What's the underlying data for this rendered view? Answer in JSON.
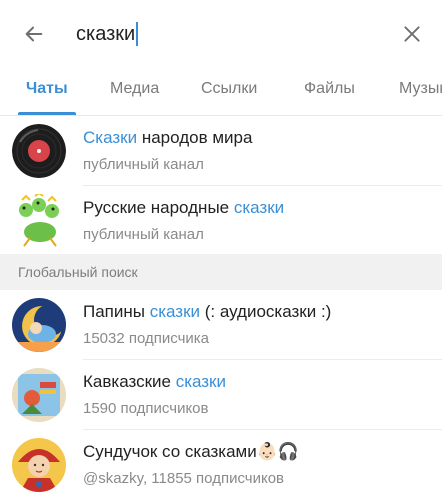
{
  "search": {
    "query": "сказки"
  },
  "tabs": [
    {
      "label": "Чаты"
    },
    {
      "label": "Медиа"
    },
    {
      "label": "Ссылки"
    },
    {
      "label": "Файлы"
    },
    {
      "label": "Музыка"
    }
  ],
  "local_results": [
    {
      "title_parts": [
        "Сказки",
        " народов мира"
      ],
      "subtitle": "публичный канал"
    },
    {
      "title_parts": [
        "Русские народные ",
        "сказки"
      ],
      "subtitle": "публичный канал"
    }
  ],
  "global_section": {
    "label": "Глобальный поиск"
  },
  "global_results": [
    {
      "title_parts": [
        "Папины ",
        "сказки",
        " (: аудиосказки :)"
      ],
      "subtitle": "15032 подписчика"
    },
    {
      "title_parts": [
        "Кавказские ",
        "сказки"
      ],
      "subtitle": "1590 подписчиков"
    },
    {
      "title": "Сундучок со сказками",
      "title_emoji": "👶🏻🎧",
      "subtitle": "@skazky, 11855 подписчиков"
    }
  ],
  "colors": {
    "accent": "#3a8fd6",
    "secondary_text": "#8a8a8a",
    "section_bg": "#f1f1f1"
  }
}
